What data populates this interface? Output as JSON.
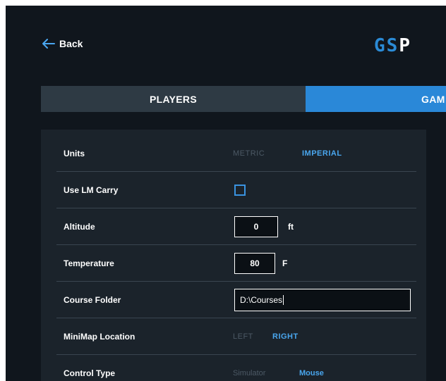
{
  "header": {
    "back_label": "Back",
    "logo_part1": "GS",
    "logo_part2": "P"
  },
  "tabs": [
    {
      "label": "PLAYERS",
      "active": false
    },
    {
      "label": "GAM",
      "active": true
    }
  ],
  "settings": {
    "units": {
      "label": "Units",
      "options": [
        "METRIC",
        "IMPERIAL"
      ],
      "selected": "IMPERIAL"
    },
    "use_lm_carry": {
      "label": "Use LM Carry",
      "checked": false
    },
    "altitude": {
      "label": "Altitude",
      "value": "0",
      "unit": "ft"
    },
    "temperature": {
      "label": "Temperature",
      "value": "80",
      "unit": "F"
    },
    "course_folder": {
      "label": "Course Folder",
      "value": "D:\\Courses"
    },
    "minimap_location": {
      "label": "MiniMap Location",
      "options": [
        "LEFT",
        "RIGHT"
      ],
      "selected": "RIGHT"
    },
    "control_type": {
      "label": "Control Type",
      "options": [
        "Simulator",
        "Mouse"
      ],
      "selected": "Mouse"
    }
  },
  "colors": {
    "background": "#10161d",
    "panel": "#1b232b",
    "accent": "#2a88d8",
    "selected_option": "#49a6ee",
    "unselected_option": "#4c5965"
  },
  "icons": {
    "back": "arrow-left-icon"
  }
}
